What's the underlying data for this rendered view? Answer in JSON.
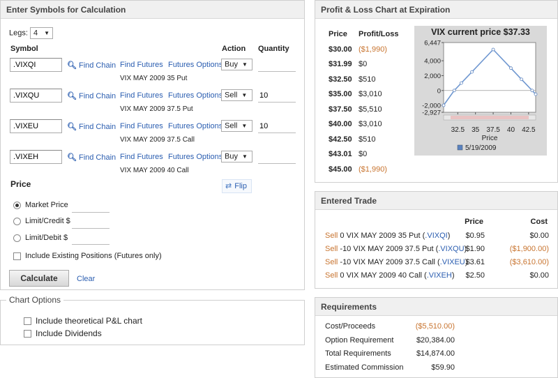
{
  "calc": {
    "title": "Enter Symbols for Calculation",
    "legs_label": "Legs:",
    "legs_value": "4",
    "col_symbol": "Symbol",
    "col_action": "Action",
    "col_quantity": "Quantity",
    "find_chain_label": "Find Chain",
    "find_futures_label": "Find Futures",
    "futures_options_label": "Futures Options",
    "legs": [
      {
        "symbol": ".VIXQI",
        "action": "Buy",
        "quantity": "",
        "desc": "VIX MAY 2009 35 Put"
      },
      {
        "symbol": ".VIXQU",
        "action": "Sell",
        "quantity": "10",
        "desc": "VIX MAY 2009 37.5 Put"
      },
      {
        "symbol": ".VIXEU",
        "action": "Sell",
        "quantity": "10",
        "desc": "VIX MAY 2009 37.5 Call"
      },
      {
        "symbol": ".VIXEH",
        "action": "Buy",
        "quantity": "",
        "desc": "VIX MAY 2009 40 Call"
      }
    ],
    "price_label": "Price",
    "flip_label": "Flip",
    "price_options": [
      {
        "label": "Market Price",
        "selected": true
      },
      {
        "label": "Limit/Credit $",
        "selected": false
      },
      {
        "label": "Limit/Debit $",
        "selected": false
      }
    ],
    "include_existing_label": "Include Existing Positions (Futures only)",
    "calculate_label": "Calculate",
    "clear_label": "Clear"
  },
  "chart_options": {
    "title": "Chart Options",
    "opt1": "Include theoretical P&L chart",
    "opt2": "Include Dividends"
  },
  "pl": {
    "title": "Profit & Loss Chart at Expiration",
    "col_price": "Price",
    "col_pl": "Profit/Loss",
    "rows": [
      {
        "price": "$30.00",
        "pl": "($1,990)",
        "neg": true
      },
      {
        "price": "$31.99",
        "pl": "$0",
        "neg": false
      },
      {
        "price": "$32.50",
        "pl": "$510",
        "neg": false
      },
      {
        "price": "$35.00",
        "pl": "$3,010",
        "neg": false
      },
      {
        "price": "$37.50",
        "pl": "$5,510",
        "neg": false
      },
      {
        "price": "$40.00",
        "pl": "$3,010",
        "neg": false
      },
      {
        "price": "$42.50",
        "pl": "$510",
        "neg": false
      },
      {
        "price": "$43.01",
        "pl": "$0",
        "neg": false
      },
      {
        "price": "$45.00",
        "pl": "($1,990)",
        "neg": true
      }
    ]
  },
  "chart_data": {
    "type": "line",
    "title": "VIX current price $37.33",
    "xlabel": "Price",
    "ylabel": "",
    "x_ticks": [
      "32.5",
      "35",
      "37.5",
      "40",
      "42.5"
    ],
    "y_ticks": [
      "6,447",
      "4,000",
      "2,000",
      "0",
      "-2,000",
      "-2,927"
    ],
    "xlim": [
      30.5,
      43.5
    ],
    "ylim": [
      -2927,
      6447
    ],
    "series": [
      {
        "name": "5/19/2009",
        "x": [
          30.5,
          32.0,
          33.0,
          34.5,
          37.5,
          40.0,
          41.5,
          43.0,
          43.5
        ],
        "y": [
          -1990,
          0,
          1000,
          2500,
          5510,
          3010,
          1500,
          0,
          -500
        ]
      }
    ],
    "legend_position": "bottom",
    "colors": {
      "line": "#6f97d0",
      "bg": "#d9d9d9",
      "plot_bg": "#ffffff",
      "marker": "#5a82bf"
    }
  },
  "trade": {
    "title": "Entered Trade",
    "col_price": "Price",
    "col_cost": "Cost",
    "rows": [
      {
        "action": "Sell",
        "desc": " 0 VIX MAY 2009 35 Put (",
        "sym": ".VIXQI",
        "close": ")",
        "price": "$0.95",
        "cost": "$0.00",
        "neg": false
      },
      {
        "action": "Sell",
        "desc": " -10 VIX MAY 2009 37.5 Put (",
        "sym": ".VIXQU",
        "close": ")",
        "price": "$1.90",
        "cost": "($1,900.00)",
        "neg": true
      },
      {
        "action": "Sell",
        "desc": " -10 VIX MAY 2009 37.5 Call (",
        "sym": ".VIXEU",
        "close": ")",
        "price": "$3.61",
        "cost": "($3,610.00)",
        "neg": true
      },
      {
        "action": "Sell",
        "desc": " 0 VIX MAY 2009 40 Call (",
        "sym": ".VIXEH",
        "close": ")",
        "price": "$2.50",
        "cost": "$0.00",
        "neg": false
      }
    ]
  },
  "req": {
    "title": "Requirements",
    "rows": [
      {
        "label": "Cost/Proceeds",
        "value": "($5,510.00)",
        "neg": true
      },
      {
        "label": "Option Requirement",
        "value": "$20,384.00",
        "neg": false
      },
      {
        "label": "Total Requirements",
        "value": "$14,874.00",
        "neg": false
      },
      {
        "label": "Estimated Commission",
        "value": "$59.90",
        "neg": false
      }
    ]
  }
}
